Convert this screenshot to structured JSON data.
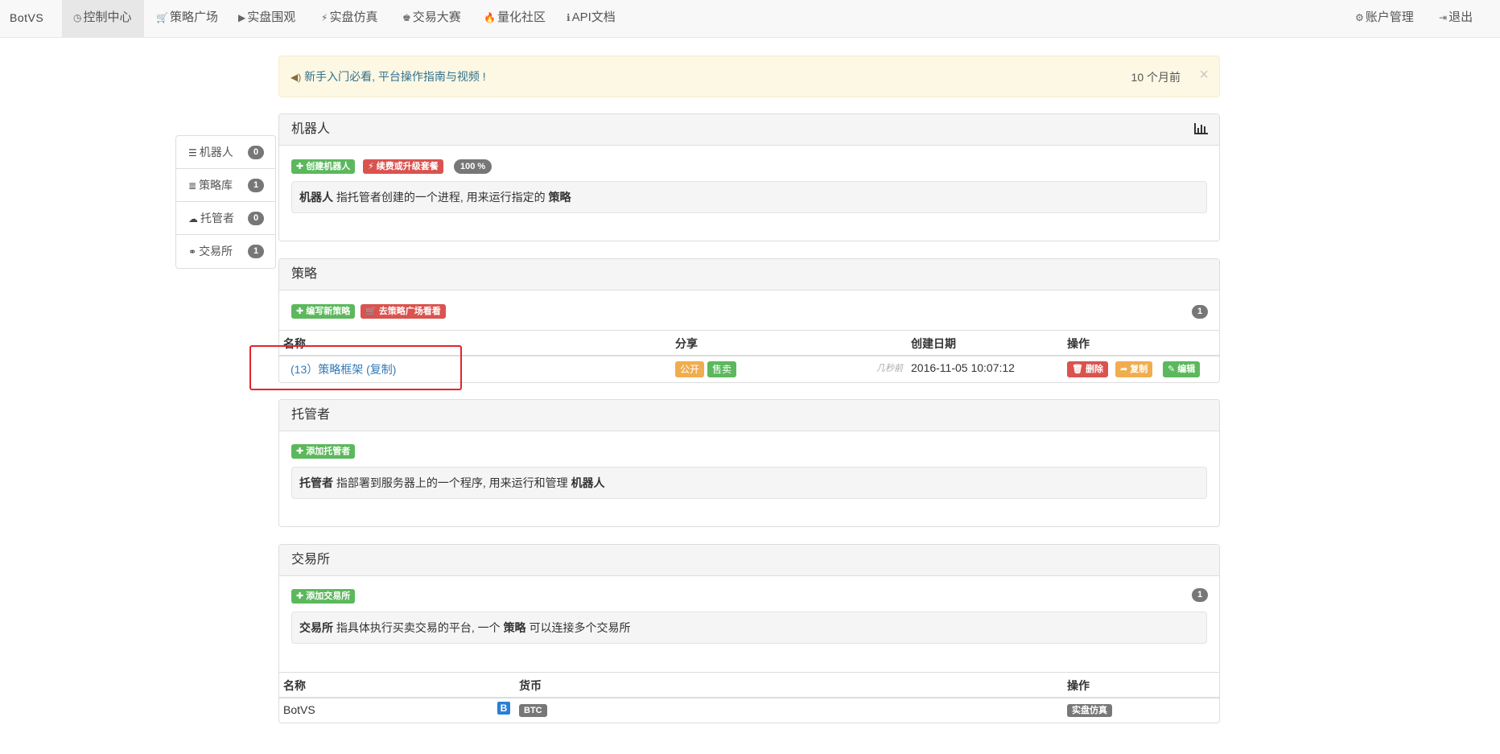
{
  "nav": {
    "brand": "BotVS",
    "items": [
      {
        "icon": "dashboard-icon",
        "glyph": "◷",
        "label": "控制中心"
      },
      {
        "icon": "cart-icon",
        "glyph": "🛒",
        "label": "策略广场"
      },
      {
        "icon": "play-circle-icon",
        "glyph": "▶",
        "label": "实盘围观"
      },
      {
        "icon": "bolt-icon",
        "glyph": "⚡",
        "label": "实盘仿真"
      },
      {
        "icon": "king-icon",
        "glyph": "♚",
        "label": "交易大赛"
      },
      {
        "icon": "fire-icon",
        "glyph": "🔥",
        "label": "量化社区"
      },
      {
        "icon": "info-icon",
        "glyph": "ℹ",
        "label": "API文档"
      }
    ],
    "right": [
      {
        "icon": "gear-icon",
        "glyph": "⚙",
        "label": "账户管理"
      },
      {
        "icon": "logout-icon",
        "glyph": "⇥",
        "label": "退出"
      }
    ]
  },
  "sidebar": {
    "items": [
      {
        "icon": "tasks-icon",
        "glyph": "☰",
        "label": "机器人",
        "count": "0"
      },
      {
        "icon": "database-icon",
        "glyph": "≣",
        "label": "策略库",
        "count": "1"
      },
      {
        "icon": "cloud-icon",
        "glyph": "☁",
        "label": "托管者",
        "count": "0"
      },
      {
        "icon": "exchange-icon",
        "glyph": "⚭",
        "label": "交易所",
        "count": "1"
      }
    ]
  },
  "alert": {
    "icon": "bullhorn-icon",
    "text": "新手入门必看, 平台操作指南与视频 !",
    "time": "10 个月前",
    "close": "×"
  },
  "robot": {
    "title": "机器人",
    "btn_create": "创建机器人",
    "btn_upgrade": "续费或升级套餐",
    "percent": "100 %",
    "desc_bold": "机器人",
    "desc_text": " 指托管者创建的一个进程, 用来运行指定的 ",
    "desc_bold2": "策略"
  },
  "strategy": {
    "title": "策略",
    "btn_new": "编写新策略",
    "btn_square": "去策略广场看看",
    "count": "1",
    "headers": {
      "name": "名称",
      "share": "分享",
      "created": "创建日期",
      "ops": "操作"
    },
    "rows": [
      {
        "name": "(13）策略框架 (复制)",
        "share_public": "公开",
        "share_sell": "售卖",
        "ago": "几秒前",
        "created": "2016-11-05 10:07:12",
        "ops": {
          "delete": "删除",
          "copy": "复制",
          "edit": "编辑"
        }
      }
    ]
  },
  "docker": {
    "title": "托管者",
    "btn_add": "添加托管者",
    "desc_bold": "托管者",
    "desc_text": " 指部署到服务器上的一个程序, 用来运行和管理 ",
    "desc_bold2": "机器人"
  },
  "exchange": {
    "title": "交易所",
    "btn_add": "添加交易所",
    "count": "1",
    "desc_bold": "交易所",
    "desc_text": " 指具体执行买卖交易的平台, 一个 ",
    "desc_bold2": "策略",
    "desc_text2": " 可以连接多个交易所",
    "headers": {
      "name": "名称",
      "currency": "货币",
      "ops": "操作"
    },
    "rows": [
      {
        "name": "BotVS",
        "icon_letter": "B",
        "currency": "BTC",
        "op": "实盘仿真"
      }
    ]
  },
  "colors": {
    "green": "#5cb85c",
    "red": "#d9534f",
    "orange": "#f0ad4e",
    "link": "#337ab7",
    "highlight": "#e0262b"
  }
}
